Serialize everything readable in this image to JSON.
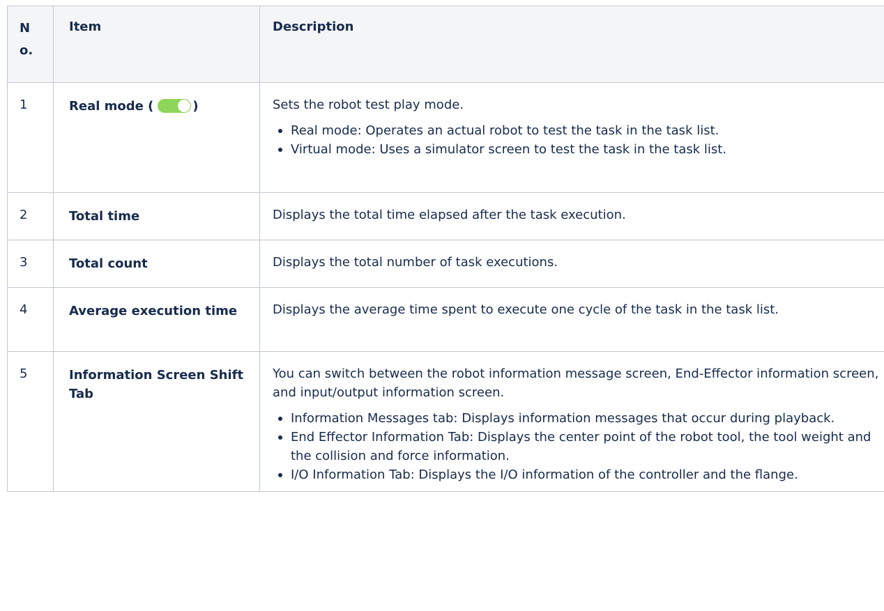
{
  "headers": {
    "no": "No.",
    "item": "Item",
    "description": "Description"
  },
  "toggle_color": "#8ed65a",
  "rows": [
    {
      "no": "1",
      "item": "Real mode (",
      "item_suffix": ")",
      "item_icon": "toggle-switch-on-icon",
      "intro": "Sets the robot test play mode.",
      "bullets": [
        "Real mode: Operates an actual robot to test the task in the task list.",
        "Virtual mode: Uses a simulator screen to test the task in the task list."
      ]
    },
    {
      "no": "2",
      "item": "Total time",
      "intro": "Displays the total time elapsed after the task execution."
    },
    {
      "no": "3",
      "item": "Total count",
      "intro": "Displays the total number of task executions."
    },
    {
      "no": "4",
      "item": "Average execution time",
      "intro": "Displays the average time spent to execute one cycle of the task in the task list."
    },
    {
      "no": "5",
      "item": "Information Screen Shift Tab",
      "intro": "You can switch between the robot information message screen, End-Effector information screen, and input/output information screen.",
      "bullets": [
        "Information Messages tab: Displays information messages that occur during playback.",
        "End Effector Information Tab: Displays the center point of the robot tool, the tool weight and the collision and force information.",
        "I/O Information Tab: Displays the I/O information of the controller and the flange."
      ]
    }
  ]
}
